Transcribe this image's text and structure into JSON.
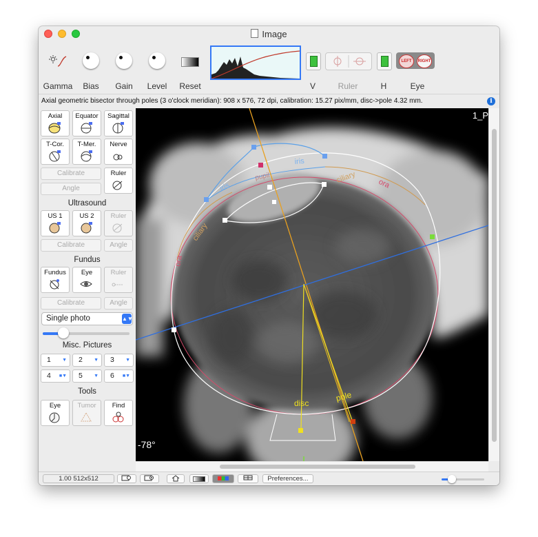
{
  "window": {
    "title": "Image"
  },
  "toolbar": {
    "labels": {
      "gamma": "Gamma",
      "bias": "Bias",
      "gain": "Gain",
      "level": "Level",
      "reset": "Reset",
      "v": "V",
      "ruler": "Ruler",
      "h": "H",
      "eye": "Eye"
    },
    "eye_left": "LEFT",
    "eye_right": "RIGHT",
    "histogram_curve_color": "#c0392b"
  },
  "info": {
    "text": "Axial geometric bisector through poles (3 o'clock meridian): 908 x 576, 72 dpi, calibration: 15.27 pix/mm, disc->pole 4.32 mm."
  },
  "sidebar": {
    "planes": [
      {
        "label": "Axial",
        "icon": "axial-eye-icon"
      },
      {
        "label": "Equator",
        "icon": "equator-eye-icon"
      },
      {
        "label": "Sagittal",
        "icon": "sagittal-eye-icon"
      },
      {
        "label": "T-Cor.",
        "icon": "t-cor-eye-icon"
      },
      {
        "label": "T-Mer.",
        "icon": "t-mer-eye-icon"
      },
      {
        "label": "Nerve",
        "icon": "nerve-icon"
      }
    ],
    "calibrate_label": "Calibrate",
    "angle_label": "Angle",
    "ruler_label": "Ruler",
    "ultrasound": {
      "title": "Ultrasound",
      "us1": "US 1",
      "us2": "US 2",
      "ruler": "Ruler"
    },
    "fundus": {
      "title": "Fundus",
      "fundus": "Fundus",
      "eye": "Eye",
      "ruler": "Ruler"
    },
    "photo_select": "Single photo",
    "slider_value": 0.2,
    "misc": {
      "title": "Misc. Pictures",
      "buttons": [
        "1",
        "2",
        "3",
        "4",
        "5",
        "6"
      ]
    },
    "tools": {
      "title": "Tools",
      "eye": "Eye",
      "tumor": "Tumor",
      "find": "Find"
    }
  },
  "viewer": {
    "corner_label": "1_P",
    "angle_label": "l: -78°",
    "annotations": {
      "iris_left": "iris",
      "iris_right": "iris",
      "pupil": "pupil",
      "ciliary_left": "ciliary",
      "ciliary_right": "ciliary",
      "ora_left": "ora",
      "ora_right": "ora",
      "disc": "disc",
      "pole": "pole"
    },
    "colors": {
      "axis_line": "#e8a020",
      "equator_line": "#2f6fe0",
      "eye_contour": "#ffffff",
      "ora_ring": "#d44a6a",
      "iris_arc": "#5aa0e8",
      "ciliary_arc": "#d09a50",
      "disc_line": "#f0e020"
    }
  },
  "statusbar": {
    "zoom": "1.00 512x512",
    "preferences": "Preferences..."
  }
}
